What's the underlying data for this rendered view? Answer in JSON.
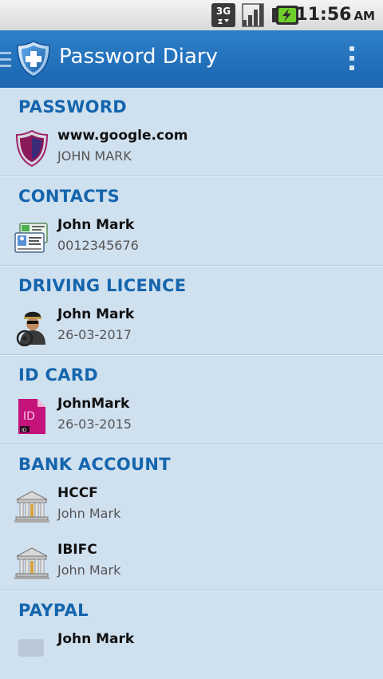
{
  "status_bar": {
    "network": "3G",
    "time": "11:56",
    "ampm": "AM"
  },
  "app_bar": {
    "title": "Password Diary"
  },
  "sections": [
    {
      "header": "PASSWORD",
      "items": [
        {
          "title": "www.google.com",
          "subtitle": "JOHN MARK",
          "icon": "shield-icon"
        }
      ]
    },
    {
      "header": "CONTACTS",
      "items": [
        {
          "title": "John Mark",
          "subtitle": "0012345676",
          "icon": "contact-card-icon"
        }
      ]
    },
    {
      "header": "DRIVING LICENCE",
      "items": [
        {
          "title": "John Mark",
          "subtitle": "26-03-2017",
          "icon": "driver-icon"
        }
      ]
    },
    {
      "header": "ID CARD",
      "items": [
        {
          "title": "JohnMark",
          "subtitle": "26-03-2015",
          "icon": "id-card-icon"
        }
      ]
    },
    {
      "header": "BANK ACCOUNT",
      "items": [
        {
          "title": "HCCF",
          "subtitle": "John Mark",
          "icon": "bank-icon"
        },
        {
          "title": "IBIFC",
          "subtitle": "John Mark",
          "icon": "bank-icon"
        }
      ]
    },
    {
      "header": "PAYPAL",
      "items": [
        {
          "title": "John Mark",
          "subtitle": "",
          "icon": "paypal-icon"
        }
      ]
    }
  ]
}
